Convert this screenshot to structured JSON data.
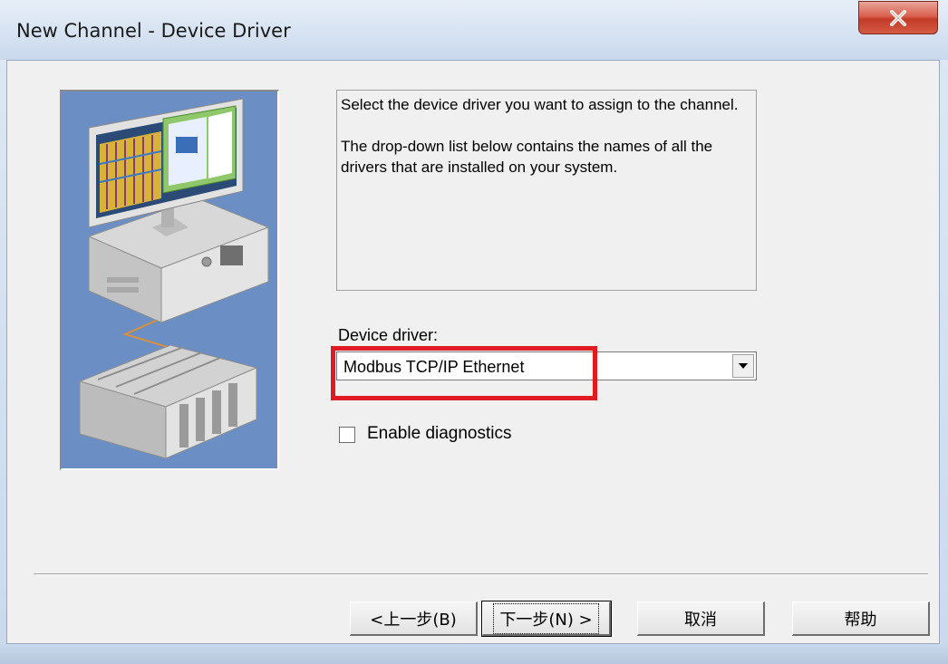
{
  "window": {
    "title": "New Channel - Device Driver",
    "close_glyph": "X"
  },
  "description": {
    "line1": "Select the device driver you want to assign to the channel.",
    "line2": "The drop-down list below contains the names of all the drivers that are installed on your system."
  },
  "driver": {
    "label": "Device driver:",
    "selected": "Modbus TCP/IP Ethernet"
  },
  "diagnostics": {
    "label": "Enable diagnostics",
    "checked": false
  },
  "buttons": {
    "back": "<上一步(B)",
    "next": "下一步(N) >",
    "cancel": "取消",
    "help": "帮助"
  },
  "colors": {
    "highlight": "#e01b24",
    "illustration_bg": "#6b8fc4"
  },
  "icons": {
    "close": "close-icon",
    "dropdown": "chevron-down-icon"
  }
}
